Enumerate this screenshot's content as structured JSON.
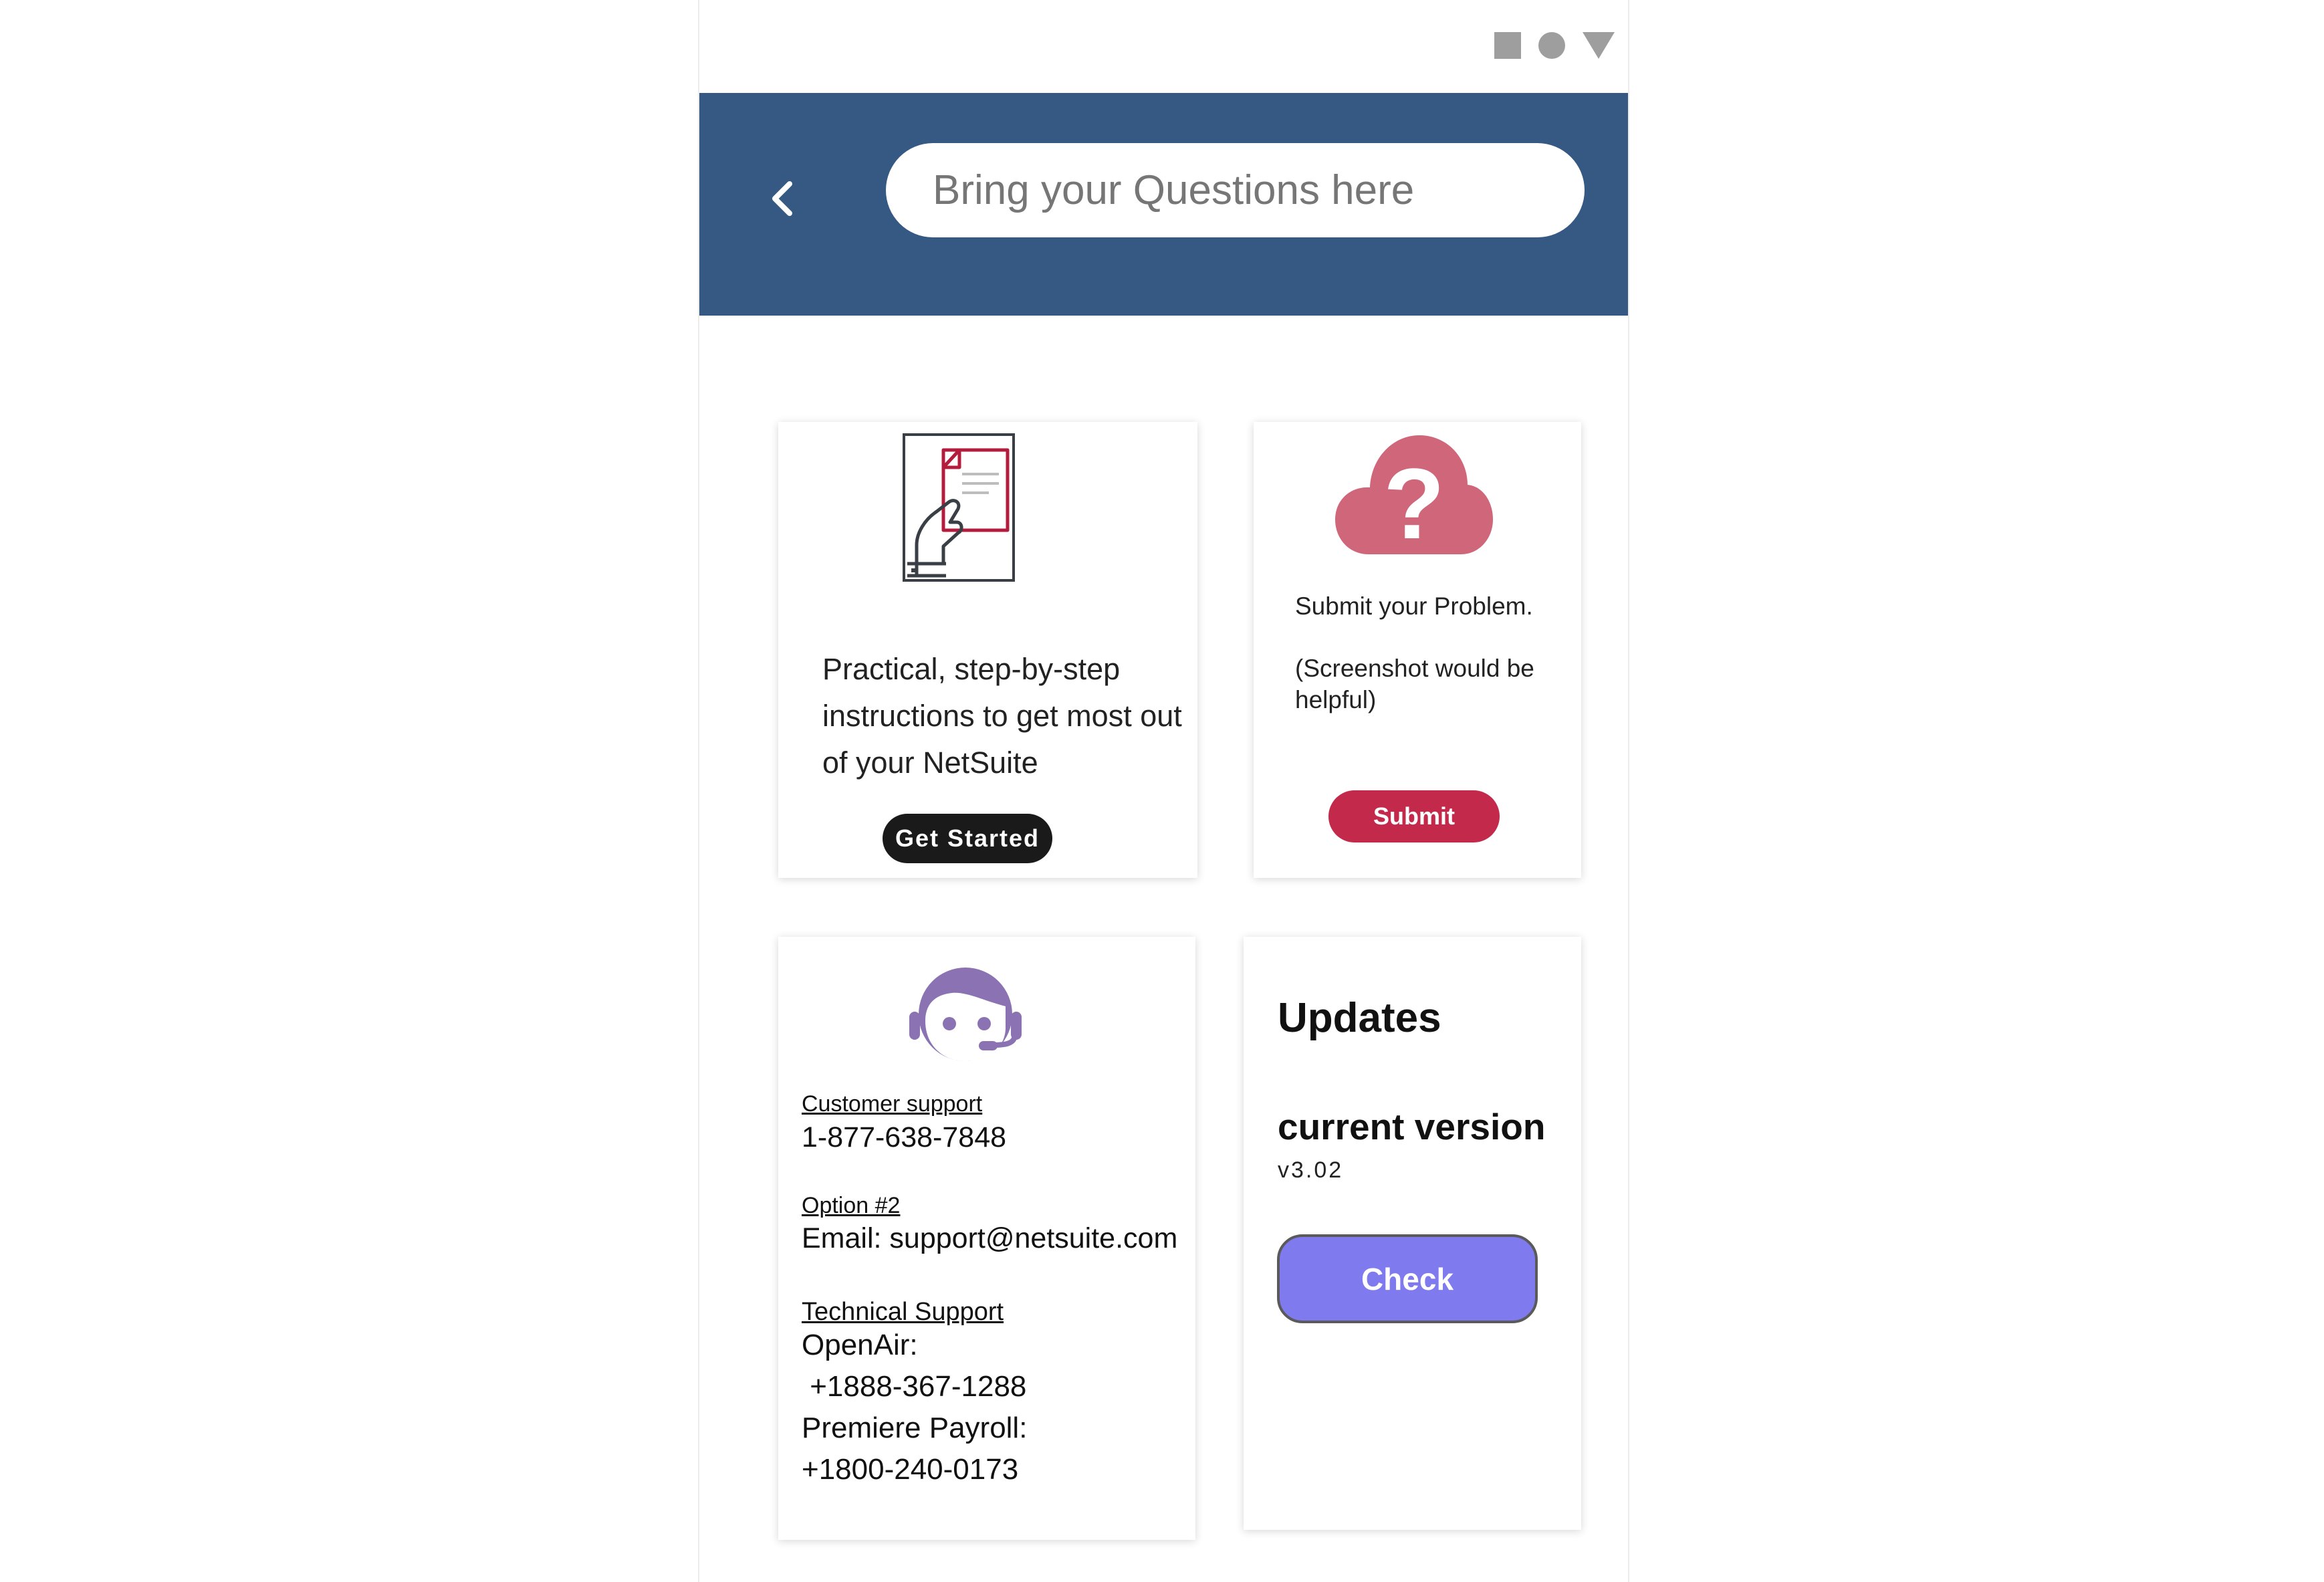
{
  "header": {
    "search_placeholder": "Bring your Questions here"
  },
  "cards": {
    "guide": {
      "description": "Practical, step-by-step instructions to get most out of your NetSuite",
      "button_label": "Get Started"
    },
    "submit": {
      "line1": "Submit your Problem.",
      "line2": "(Screenshot would be helpful)",
      "button_label": "Submit"
    },
    "support": {
      "customer_support_label": "Customer support",
      "customer_support_phone": "1-877-638-7848",
      "option2_label": "Option #2",
      "email": "Email: support@netsuite.com",
      "technical_support_label": "Technical Support",
      "openair_label": "OpenAir:",
      "openair_phone": " +1888-367-1288",
      "payroll_label": "Premiere Payroll:",
      "payroll_phone": "+1800-240-0173"
    },
    "updates": {
      "title": "Updates",
      "current_version_label": "current version",
      "version": "v3.02",
      "button_label": "Check"
    }
  },
  "colors": {
    "header_bg": "#355983",
    "submit_red": "#c2294a",
    "cloud_pink": "#d0667a",
    "agent_purple": "#8b72b3",
    "check_purple": "#7f7aee"
  },
  "icons": {
    "status": [
      "square-icon",
      "circle-icon",
      "triangle-icon"
    ],
    "back": "chevron-left-icon",
    "guide": "hand-document-icon",
    "submit": "cloud-question-icon",
    "support": "support-agent-icon"
  }
}
